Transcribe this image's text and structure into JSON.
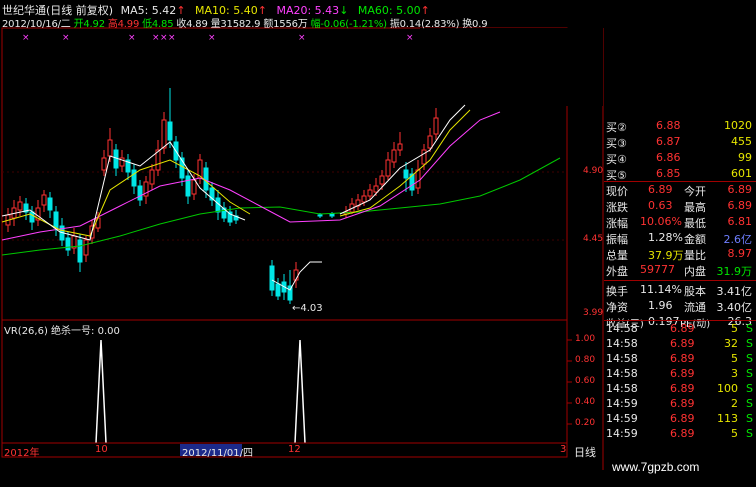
{
  "header": {
    "stock_name": "世纪华通(日线 前复权)",
    "ma5": "MA5: 5.42",
    "ma10": "MA10: 5.40",
    "ma20": "MA20: 5.43",
    "ma60": "MA60: 5.00",
    "date_label": "2012/10/16/二",
    "open": "开4.92",
    "high": "高4.99",
    "low": "低4.85",
    "close": "收4.89",
    "vol": "量31582.9",
    "amount": "额1556万",
    "change": "幅-0.06(-1.21%)",
    "amp": "振0.14(2.83%)",
    "turnover": "换0.9"
  },
  "price_axis": [
    "4.90",
    "4.45",
    "3.99"
  ],
  "annotation_low": "←4.03",
  "indicator": {
    "title": "VR(26,6)  绝杀一号: 0.00",
    "axis": [
      "1.00",
      "0.80",
      "0.60",
      "0.40",
      "0.20"
    ]
  },
  "date_axis": {
    "year": "2012年",
    "m10": "10",
    "cursor_date": "2012/11/01/四",
    "m12": "12",
    "m3": "3"
  },
  "period_tab": "日线",
  "book": [
    {
      "label": "买②",
      "price": "6.88",
      "vol": "1020"
    },
    {
      "label": "买③",
      "price": "6.87",
      "vol": "455"
    },
    {
      "label": "买④",
      "price": "6.86",
      "vol": "99"
    },
    {
      "label": "买⑤",
      "price": "6.85",
      "vol": "601"
    }
  ],
  "quote": [
    {
      "l1": "现价",
      "v1": "6.89",
      "l2": "今开",
      "v2": "6.89"
    },
    {
      "l1": "涨跌",
      "v1": "0.63",
      "l2": "最高",
      "v2": "6.89"
    },
    {
      "l1": "涨幅",
      "v1": "10.06%",
      "l2": "最低",
      "v2": "6.81"
    },
    {
      "l1": "振幅",
      "v1": "1.28%",
      "l2": "金额",
      "v2": "2.6亿"
    },
    {
      "l1": "总量",
      "v1": "37.9万",
      "l2": "量比",
      "v2": "8.97"
    },
    {
      "l1": "外盘",
      "v1": "59777",
      "l2": "内盘",
      "v2": "31.9万"
    }
  ],
  "fundamentals": [
    {
      "l1": "换手",
      "v1": "11.14%",
      "l2": "股本",
      "v2": "3.41亿"
    },
    {
      "l1": "净资",
      "v1": "1.96",
      "l2": "流通",
      "v2": "3.40亿"
    },
    {
      "l1": "收益(三)",
      "v1": "0.197",
      "l2": "PE(动)",
      "v2": "26.3"
    }
  ],
  "ticks": [
    {
      "time": "14:58",
      "price": "6.89",
      "vol": "5",
      "side": "S"
    },
    {
      "time": "14:58",
      "price": "6.89",
      "vol": "32",
      "side": "S"
    },
    {
      "time": "14:58",
      "price": "6.89",
      "vol": "5",
      "side": "S"
    },
    {
      "time": "14:58",
      "price": "6.89",
      "vol": "3",
      "side": "S"
    },
    {
      "time": "14:58",
      "price": "6.89",
      "vol": "100",
      "side": "S"
    },
    {
      "time": "14:59",
      "price": "6.89",
      "vol": "2",
      "side": "S"
    },
    {
      "time": "14:59",
      "price": "6.89",
      "vol": "113",
      "side": "S"
    },
    {
      "time": "14:59",
      "price": "6.89",
      "vol": "5",
      "side": "S"
    }
  ],
  "watermark": "www.7gpzb.com",
  "colors": {
    "up": "#ff3232",
    "down": "#00e6e6",
    "ma5": "#ffffff",
    "ma10": "#e6e600",
    "ma20": "#ff40ff",
    "ma60": "#00c800",
    "grid": "#a00000"
  }
}
